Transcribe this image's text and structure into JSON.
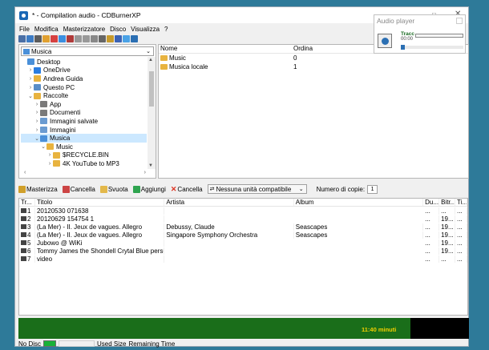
{
  "window": {
    "title": "* - Compilation audio - CDBurnerXP"
  },
  "menu": [
    "File",
    "Modifica",
    "Masterizzatore",
    "Disco",
    "Visualizza",
    "?"
  ],
  "iconbar_colors": [
    "#4a6fa5",
    "#3c7bc4",
    "#5c5c5c",
    "#e0a030",
    "#d64040",
    "#3b8fe0",
    "#b03a3a",
    "#999",
    "#999",
    "#888",
    "#666",
    "#c79b2c",
    "#3b63b5",
    "#4aa2e6",
    "#2b6fb3"
  ],
  "tree": {
    "location": "Musica",
    "items": [
      {
        "label": "Desktop",
        "indent": 0,
        "expander": "",
        "icon": "#4a90d9"
      },
      {
        "label": "OneDrive",
        "indent": 1,
        "expander": "›",
        "icon": "#2a7de1"
      },
      {
        "label": "Andrea Guida",
        "indent": 1,
        "expander": "›",
        "icon": "#e8b33f"
      },
      {
        "label": "Questo PC",
        "indent": 1,
        "expander": "›",
        "icon": "#5a8ec7"
      },
      {
        "label": "Raccolte",
        "indent": 1,
        "expander": "⌄",
        "icon": "#e8b33f"
      },
      {
        "label": "App",
        "indent": 2,
        "expander": "›",
        "icon": "#7a7a7a"
      },
      {
        "label": "Documenti",
        "indent": 2,
        "expander": "›",
        "icon": "#7a7a7a"
      },
      {
        "label": "Immagini salvate",
        "indent": 2,
        "expander": "›",
        "icon": "#6a9bd1"
      },
      {
        "label": "Immagini",
        "indent": 2,
        "expander": "›",
        "icon": "#6a9bd1"
      },
      {
        "label": "Musica",
        "indent": 2,
        "expander": "⌄",
        "icon": "#4a90d9",
        "selected": true
      },
      {
        "label": "Music",
        "indent": 3,
        "expander": "⌄",
        "icon": "#e8b33f"
      },
      {
        "label": "$RECYCLE.BIN",
        "indent": 4,
        "expander": "›",
        "icon": "#e8b33f"
      },
      {
        "label": "4K YouTube to MP3",
        "indent": 4,
        "expander": "›",
        "icon": "#e8b33f"
      },
      {
        "label": "",
        "indent": 4,
        "expander": "›",
        "icon": "#e8b33f"
      }
    ]
  },
  "files": {
    "headers": {
      "name": "Nome",
      "order": "Ordina"
    },
    "rows": [
      {
        "name": "Music",
        "order": "0"
      },
      {
        "name": "Musica locale",
        "order": "1"
      }
    ]
  },
  "toolbar2": {
    "burn": "Masterizza",
    "delete": "Cancella",
    "empty": "Svuota",
    "add": "Aggiungi",
    "remove": "Cancella",
    "device": "Nessuna unità compatibile",
    "copies_label": "Numero di copie:",
    "copies_value": "1"
  },
  "tracks": {
    "headers": {
      "track": "Tr...",
      "title": "Titolo",
      "artist": "Artista",
      "album": "Album",
      "duration": "Du...",
      "bitrate": "Bitr...",
      "extra": "Ti..."
    },
    "rows": [
      {
        "n": "1",
        "title": "20120530 071638",
        "artist": "",
        "album": "",
        "duration": "...",
        "bitrate": "...",
        "extra": "..."
      },
      {
        "n": "2",
        "title": "20120629 154754 1",
        "artist": "",
        "album": "",
        "duration": "...",
        "bitrate": "19...",
        "extra": "..."
      },
      {
        "n": "3",
        "title": "(La Mer) - II. Jeux de vagues. Allegro",
        "artist": "Debussy, Claude",
        "album": "Seascapes",
        "duration": "...",
        "bitrate": "19...",
        "extra": "..."
      },
      {
        "n": "4",
        "title": "(La Mer) - II. Jeux de vagues. Allegro",
        "artist": "Singapore Symphony Orchestra",
        "album": "Seascapes",
        "duration": "...",
        "bitrate": "19...",
        "extra": "..."
      },
      {
        "n": "5",
        "title": "Jubowo @ WiKi",
        "artist": "",
        "album": "",
        "duration": "...",
        "bitrate": "19...",
        "extra": "..."
      },
      {
        "n": "6",
        "title": "Tommy James the Shondell Crytal Blue persua...",
        "artist": "",
        "album": "",
        "duration": "...",
        "bitrate": "19...",
        "extra": "..."
      },
      {
        "n": "7",
        "title": "video",
        "artist": "",
        "album": "",
        "duration": "...",
        "bitrate": "...",
        "extra": "..."
      }
    ]
  },
  "progress": {
    "minutes_label": "11:40 minuti",
    "fill_fraction": 0.87
  },
  "status": {
    "disc": "No Disc",
    "used": "Used Size",
    "remaining": "Remaining Time"
  },
  "player": {
    "title": "Audio player",
    "track_label": "Tracc",
    "time": "00:00"
  }
}
